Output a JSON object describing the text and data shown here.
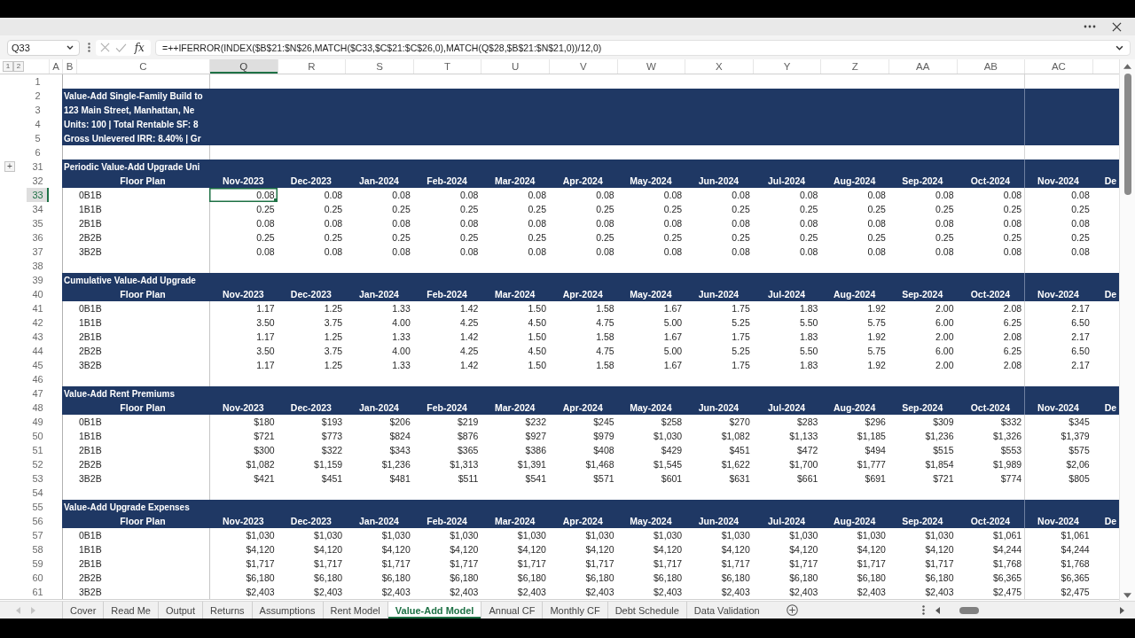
{
  "formula_bar": {
    "cell_reference": "Q33",
    "function_button": "fx",
    "formula": "=++IFERROR(INDEX($B$21:$N$26,MATCH($C33,$C$21:$C$26,0),MATCH(Q$28,$B$21:$N$21,0))/12,0)"
  },
  "sheet": {
    "outline_levels": [
      "1",
      "2"
    ],
    "columns": [
      {
        "label": "A",
        "selected": false
      },
      {
        "label": "B",
        "selected": false
      },
      {
        "label": "C",
        "selected": false
      },
      {
        "label": "Q",
        "selected": true
      },
      {
        "label": "R",
        "selected": false
      },
      {
        "label": "S",
        "selected": false
      },
      {
        "label": "T",
        "selected": false
      },
      {
        "label": "U",
        "selected": false
      },
      {
        "label": "V",
        "selected": false
      },
      {
        "label": "W",
        "selected": false
      },
      {
        "label": "X",
        "selected": false
      },
      {
        "label": "Y",
        "selected": false
      },
      {
        "label": "Z",
        "selected": false
      },
      {
        "label": "AA",
        "selected": false
      },
      {
        "label": "AB",
        "selected": false
      },
      {
        "label": "AC",
        "selected": false
      }
    ],
    "rows": [
      {
        "number": "1",
        "kind": "blank",
        "selected": false
      },
      {
        "number": "2",
        "kind": "banner",
        "text": "Value-Add Single-Family Build to",
        "selected": false
      },
      {
        "number": "3",
        "kind": "banner",
        "text": "123 Main Street, Manhattan, Ne",
        "selected": false
      },
      {
        "number": "4",
        "kind": "banner",
        "text": "Units: 100 | Total Rentable SF: 8",
        "selected": false
      },
      {
        "number": "5",
        "kind": "banner",
        "text": "Gross Unlevered IRR: 8.40% | Gr",
        "selected": false
      },
      {
        "number": "6",
        "kind": "blank",
        "selected": false
      },
      {
        "number": "31",
        "kind": "section_title",
        "text": "Periodic Value-Add Upgrade Uni",
        "outline_button": "+",
        "selected": false
      },
      {
        "number": "32",
        "kind": "header",
        "label": "Floor Plan",
        "cells": [
          "Nov-2023",
          "Dec-2023",
          "Jan-2024",
          "Feb-2024",
          "Mar-2024",
          "Apr-2024",
          "May-2024",
          "Jun-2024",
          "Jul-2024",
          "Aug-2024",
          "Sep-2024",
          "Oct-2024",
          "Nov-2024",
          "De"
        ],
        "selected": false
      },
      {
        "number": "33",
        "kind": "data",
        "label": "0B1B",
        "cells": [
          "0.08",
          "0.08",
          "0.08",
          "0.08",
          "0.08",
          "0.08",
          "0.08",
          "0.08",
          "0.08",
          "0.08",
          "0.08",
          "0.08",
          "0.08"
        ],
        "selected": true
      },
      {
        "number": "34",
        "kind": "data",
        "label": "1B1B",
        "cells": [
          "0.25",
          "0.25",
          "0.25",
          "0.25",
          "0.25",
          "0.25",
          "0.25",
          "0.25",
          "0.25",
          "0.25",
          "0.25",
          "0.25",
          "0.25"
        ],
        "selected": false
      },
      {
        "number": "35",
        "kind": "data",
        "label": "2B1B",
        "cells": [
          "0.08",
          "0.08",
          "0.08",
          "0.08",
          "0.08",
          "0.08",
          "0.08",
          "0.08",
          "0.08",
          "0.08",
          "0.08",
          "0.08",
          "0.08"
        ],
        "selected": false
      },
      {
        "number": "36",
        "kind": "data",
        "label": "2B2B",
        "cells": [
          "0.25",
          "0.25",
          "0.25",
          "0.25",
          "0.25",
          "0.25",
          "0.25",
          "0.25",
          "0.25",
          "0.25",
          "0.25",
          "0.25",
          "0.25"
        ],
        "selected": false
      },
      {
        "number": "37",
        "kind": "data",
        "label": "3B2B",
        "cells": [
          "0.08",
          "0.08",
          "0.08",
          "0.08",
          "0.08",
          "0.08",
          "0.08",
          "0.08",
          "0.08",
          "0.08",
          "0.08",
          "0.08",
          "0.08"
        ],
        "selected": false
      },
      {
        "number": "38",
        "kind": "blank",
        "selected": false
      },
      {
        "number": "39",
        "kind": "section_title",
        "text": "Cumulative Value-Add Upgrade",
        "selected": false
      },
      {
        "number": "40",
        "kind": "header",
        "label": "Floor Plan",
        "cells": [
          "Nov-2023",
          "Dec-2023",
          "Jan-2024",
          "Feb-2024",
          "Mar-2024",
          "Apr-2024",
          "May-2024",
          "Jun-2024",
          "Jul-2024",
          "Aug-2024",
          "Sep-2024",
          "Oct-2024",
          "Nov-2024",
          "De"
        ],
        "selected": false
      },
      {
        "number": "41",
        "kind": "data",
        "label": "0B1B",
        "cells": [
          "1.17",
          "1.25",
          "1.33",
          "1.42",
          "1.50",
          "1.58",
          "1.67",
          "1.75",
          "1.83",
          "1.92",
          "2.00",
          "2.08",
          "2.17"
        ],
        "selected": false
      },
      {
        "number": "42",
        "kind": "data",
        "label": "1B1B",
        "cells": [
          "3.50",
          "3.75",
          "4.00",
          "4.25",
          "4.50",
          "4.75",
          "5.00",
          "5.25",
          "5.50",
          "5.75",
          "6.00",
          "6.25",
          "6.50"
        ],
        "selected": false
      },
      {
        "number": "43",
        "kind": "data",
        "label": "2B1B",
        "cells": [
          "1.17",
          "1.25",
          "1.33",
          "1.42",
          "1.50",
          "1.58",
          "1.67",
          "1.75",
          "1.83",
          "1.92",
          "2.00",
          "2.08",
          "2.17"
        ],
        "selected": false
      },
      {
        "number": "44",
        "kind": "data",
        "label": "2B2B",
        "cells": [
          "3.50",
          "3.75",
          "4.00",
          "4.25",
          "4.50",
          "4.75",
          "5.00",
          "5.25",
          "5.50",
          "5.75",
          "6.00",
          "6.25",
          "6.50"
        ],
        "selected": false
      },
      {
        "number": "45",
        "kind": "data",
        "label": "3B2B",
        "cells": [
          "1.17",
          "1.25",
          "1.33",
          "1.42",
          "1.50",
          "1.58",
          "1.67",
          "1.75",
          "1.83",
          "1.92",
          "2.00",
          "2.08",
          "2.17"
        ],
        "selected": false
      },
      {
        "number": "46",
        "kind": "blank",
        "selected": false
      },
      {
        "number": "47",
        "kind": "section_title",
        "text": "Value-Add Rent Premiums",
        "selected": false
      },
      {
        "number": "48",
        "kind": "header",
        "label": "Floor Plan",
        "cells": [
          "Nov-2023",
          "Dec-2023",
          "Jan-2024",
          "Feb-2024",
          "Mar-2024",
          "Apr-2024",
          "May-2024",
          "Jun-2024",
          "Jul-2024",
          "Aug-2024",
          "Sep-2024",
          "Oct-2024",
          "Nov-2024",
          "De"
        ],
        "selected": false
      },
      {
        "number": "49",
        "kind": "data",
        "label": "0B1B",
        "cells": [
          "$180",
          "$193",
          "$206",
          "$219",
          "$232",
          "$245",
          "$258",
          "$270",
          "$283",
          "$296",
          "$309",
          "$332",
          "$345"
        ],
        "selected": false
      },
      {
        "number": "50",
        "kind": "data",
        "label": "1B1B",
        "cells": [
          "$721",
          "$773",
          "$824",
          "$876",
          "$927",
          "$979",
          "$1,030",
          "$1,082",
          "$1,133",
          "$1,185",
          "$1,236",
          "$1,326",
          "$1,379"
        ],
        "selected": false
      },
      {
        "number": "51",
        "kind": "data",
        "label": "2B1B",
        "cells": [
          "$300",
          "$322",
          "$343",
          "$365",
          "$386",
          "$408",
          "$429",
          "$451",
          "$472",
          "$494",
          "$515",
          "$553",
          "$575"
        ],
        "selected": false
      },
      {
        "number": "52",
        "kind": "data",
        "label": "2B2B",
        "cells": [
          "$1,082",
          "$1,159",
          "$1,236",
          "$1,313",
          "$1,391",
          "$1,468",
          "$1,545",
          "$1,622",
          "$1,700",
          "$1,777",
          "$1,854",
          "$1,989",
          "$2,06"
        ],
        "selected": false
      },
      {
        "number": "53",
        "kind": "data",
        "label": "3B2B",
        "cells": [
          "$421",
          "$451",
          "$481",
          "$511",
          "$541",
          "$571",
          "$601",
          "$631",
          "$661",
          "$691",
          "$721",
          "$774",
          "$805"
        ],
        "selected": false
      },
      {
        "number": "54",
        "kind": "blank",
        "selected": false
      },
      {
        "number": "55",
        "kind": "section_title",
        "text": "Value-Add Upgrade Expenses",
        "selected": false
      },
      {
        "number": "56",
        "kind": "header",
        "label": "Floor Plan",
        "cells": [
          "Nov-2023",
          "Dec-2023",
          "Jan-2024",
          "Feb-2024",
          "Mar-2024",
          "Apr-2024",
          "May-2024",
          "Jun-2024",
          "Jul-2024",
          "Aug-2024",
          "Sep-2024",
          "Oct-2024",
          "Nov-2024",
          "De"
        ],
        "selected": false
      },
      {
        "number": "57",
        "kind": "data",
        "label": "0B1B",
        "cells": [
          "$1,030",
          "$1,030",
          "$1,030",
          "$1,030",
          "$1,030",
          "$1,030",
          "$1,030",
          "$1,030",
          "$1,030",
          "$1,030",
          "$1,030",
          "$1,061",
          "$1,061"
        ],
        "selected": false
      },
      {
        "number": "58",
        "kind": "data",
        "label": "1B1B",
        "cells": [
          "$4,120",
          "$4,120",
          "$4,120",
          "$4,120",
          "$4,120",
          "$4,120",
          "$4,120",
          "$4,120",
          "$4,120",
          "$4,120",
          "$4,120",
          "$4,244",
          "$4,244"
        ],
        "selected": false
      },
      {
        "number": "59",
        "kind": "data",
        "label": "2B1B",
        "cells": [
          "$1,717",
          "$1,717",
          "$1,717",
          "$1,717",
          "$1,717",
          "$1,717",
          "$1,717",
          "$1,717",
          "$1,717",
          "$1,717",
          "$1,717",
          "$1,768",
          "$1,768"
        ],
        "selected": false
      },
      {
        "number": "60",
        "kind": "data",
        "label": "2B2B",
        "cells": [
          "$6,180",
          "$6,180",
          "$6,180",
          "$6,180",
          "$6,180",
          "$6,180",
          "$6,180",
          "$6,180",
          "$6,180",
          "$6,180",
          "$6,180",
          "$6,365",
          "$6,365"
        ],
        "selected": false
      },
      {
        "number": "61",
        "kind": "data",
        "label": "3B2B",
        "cells": [
          "$2,403",
          "$2,403",
          "$2,403",
          "$2,403",
          "$2,403",
          "$2,403",
          "$2,403",
          "$2,403",
          "$2,403",
          "$2,403",
          "$2,403",
          "$2,475",
          "$2,475"
        ],
        "selected": false
      }
    ]
  },
  "sheet_tabs": [
    {
      "label": "Cover",
      "selected": false
    },
    {
      "label": "Read Me",
      "selected": false
    },
    {
      "label": "Output",
      "selected": false
    },
    {
      "label": "Returns",
      "selected": false
    },
    {
      "label": "Assumptions",
      "selected": false
    },
    {
      "label": "Rent Model",
      "selected": false
    },
    {
      "label": "Value-Add Model",
      "selected": true
    },
    {
      "label": "Annual CF",
      "selected": false
    },
    {
      "label": "Monthly CF",
      "selected": false
    },
    {
      "label": "Debt Schedule",
      "selected": false
    },
    {
      "label": "Data Validation",
      "selected": false
    }
  ]
}
